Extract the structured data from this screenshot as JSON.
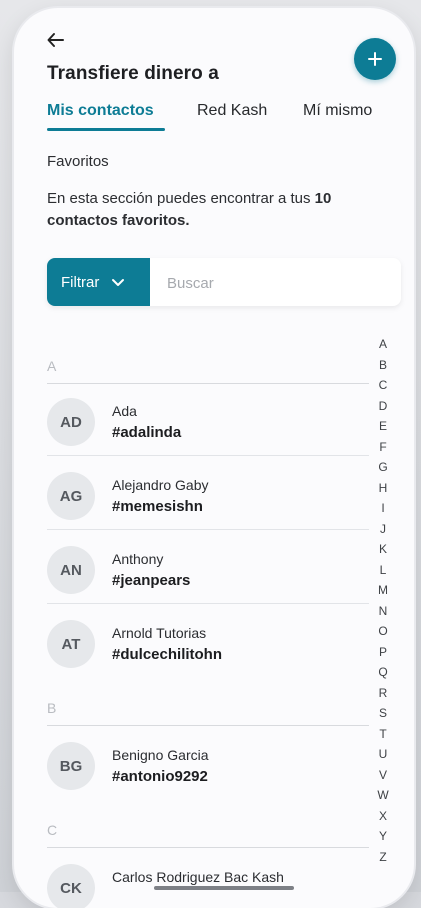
{
  "header": {
    "title": "Transfiere dinero a",
    "back_icon": "arrow-left-icon",
    "add_icon": "plus-icon"
  },
  "tabs": [
    {
      "label": "Mis contactos",
      "active": true
    },
    {
      "label": "Red Kash",
      "active": false
    },
    {
      "label": "Mí mismo",
      "active": false
    }
  ],
  "favorites": {
    "title": "Favoritos",
    "desc_prefix": "En esta sección puedes encontrar a tus ",
    "desc_bold": "10 contactos favoritos."
  },
  "search": {
    "filter_label": "Filtrar",
    "placeholder": "Buscar",
    "value": ""
  },
  "groups": [
    {
      "letter": "A"
    },
    {
      "letter": "B"
    },
    {
      "letter": "C"
    }
  ],
  "contacts": [
    {
      "initials": "AD",
      "name": "Ada",
      "handle": "#adalinda"
    },
    {
      "initials": "AG",
      "name": "Alejandro Gaby",
      "handle": "#memesishn"
    },
    {
      "initials": "AN",
      "name": "Anthony",
      "handle": "#jeanpears"
    },
    {
      "initials": "AT",
      "name": "Arnold Tutorias",
      "handle": "#dulcechilitohn"
    },
    {
      "initials": "BG",
      "name": "Benigno Garcia",
      "handle": "#antonio9292"
    },
    {
      "initials": "CK",
      "name": "Carlos Rodriguez Bac Kash",
      "handle": ""
    }
  ],
  "alphabet": [
    "A",
    "B",
    "C",
    "D",
    "E",
    "F",
    "G",
    "H",
    "I",
    "J",
    "K",
    "L",
    "M",
    "N",
    "O",
    "P",
    "Q",
    "R",
    "S",
    "T",
    "U",
    "V",
    "W",
    "X",
    "Y",
    "Z"
  ],
  "colors": {
    "accent": "#0d7c95"
  }
}
